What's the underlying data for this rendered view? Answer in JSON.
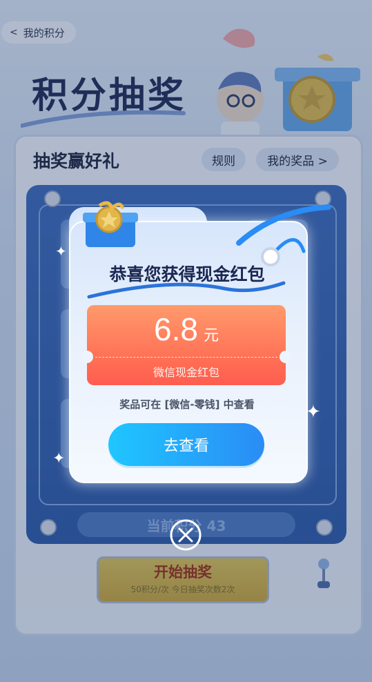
{
  "header": {
    "back_label": "我的积分",
    "back_icon": "chevron-left-icon"
  },
  "hero": {
    "title": "积分抽奖"
  },
  "panel": {
    "title": "抽奖赢好礼",
    "rules_label": "规则",
    "my_prizes_label": "我的奖品 >"
  },
  "machine": {
    "score_text": "当前积分 43",
    "start_label": "开始抽奖",
    "start_sub": "50积分/次 今日抽奖次数2次"
  },
  "modal": {
    "title": "恭喜您获得现金红包",
    "amount": "6.8",
    "unit": "元",
    "coupon_label": "微信现金红包",
    "hint": "奖品可在 [微信-零钱] 中查看",
    "view_label": "去查看"
  },
  "colors": {
    "accent": "#2a8cf5",
    "coupon": "#ff6e55",
    "title": "#1a2750"
  }
}
